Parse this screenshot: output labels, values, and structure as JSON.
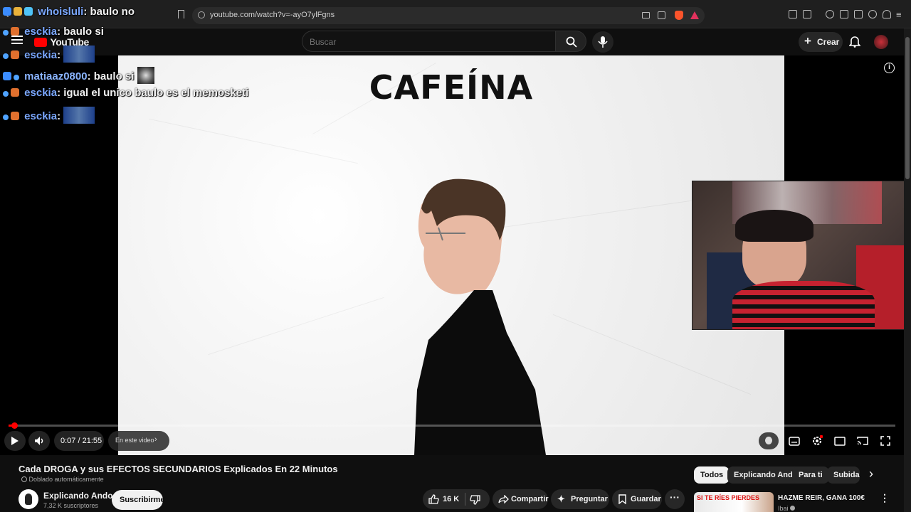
{
  "browser": {
    "url": "youtube.com/watch?v=-ayO7ylFgns"
  },
  "header": {
    "logo_text": "YouTube",
    "search_placeholder": "Buscar",
    "create_label": "Crear"
  },
  "chat": [
    {
      "user": "whoisluli",
      "message": ": baulo no"
    },
    {
      "user": "esckia",
      "message": ": baulo si"
    },
    {
      "user": "esckia",
      "message": ":"
    },
    {
      "user": "matiaaz0800",
      "message": ": baulo si"
    },
    {
      "user": "esckia",
      "message": ": igual el unico baulo es el memosketi"
    },
    {
      "user": "esckia",
      "message": ":"
    }
  ],
  "video": {
    "title_overlay": "CAFEÍNA",
    "time": "0:07 / 21:55",
    "in_video_label": "En este video",
    "progress": 0.0053
  },
  "details": {
    "title": "Cada DROGA y sus EFECTOS SECUNDARIOS Explicados En 22 Minutos",
    "dubbed": "Doblado automáticamente",
    "channel": "Explicando Ando",
    "subscribers": "7,32 K suscriptores",
    "subscribe_label": "Suscribirme",
    "likes": "16 K",
    "share_label": "Compartir",
    "ask_label": "Preguntar",
    "save_label": "Guardar"
  },
  "chips": [
    "Todos",
    "Explicando Ando",
    "Para ti",
    "Subidas"
  ],
  "recommended": {
    "thumb_text": "SI TE RÍES PIERDES",
    "title": "HAZME REIR, GANA 100€",
    "channel": "Ibai"
  },
  "colors": {
    "accent": "#ff0000",
    "chat_name": "#7aa7ff",
    "background": "#0f0f0f"
  }
}
